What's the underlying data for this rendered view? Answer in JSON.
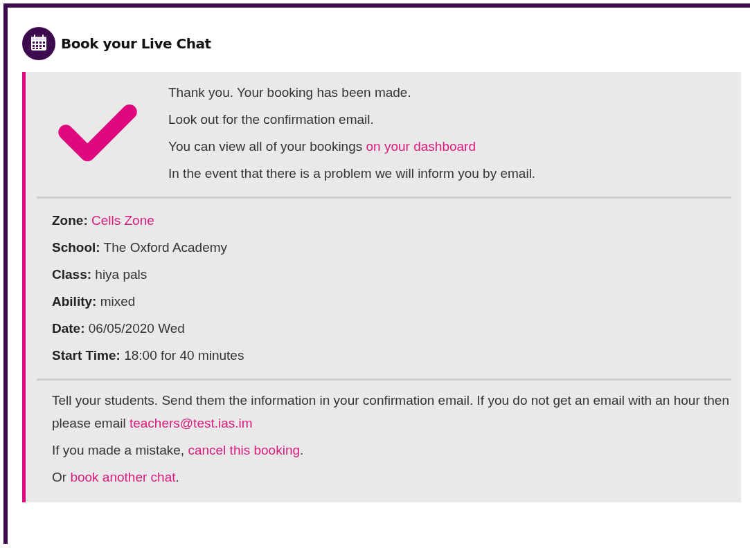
{
  "title": "Book your Live Chat",
  "confirmation": [
    [
      {
        "kind": "text",
        "text": "Thank you. Your booking has been made."
      }
    ],
    [
      {
        "kind": "text",
        "text": "Look out for the confirmation email."
      }
    ],
    [
      {
        "kind": "text",
        "text": "You can view all of your bookings "
      },
      {
        "kind": "link",
        "text": "on your dashboard"
      }
    ],
    [
      {
        "kind": "text",
        "text": "In the event that there is a problem we will inform you by email."
      }
    ]
  ],
  "details": [
    {
      "label": "Zone:",
      "value": "Cells Zone",
      "kind": "link"
    },
    {
      "label": "School:",
      "value": "The Oxford Academy",
      "kind": "text"
    },
    {
      "label": "Class:",
      "value": "hiya pals",
      "kind": "text"
    },
    {
      "label": "Ability:",
      "value": "mixed",
      "kind": "text"
    },
    {
      "label": "Date:",
      "value": "06/05/2020 Wed",
      "kind": "text"
    },
    {
      "label": "Start Time:",
      "value": "18:00 for 40 minutes",
      "kind": "text"
    }
  ],
  "next_steps": [
    [
      {
        "kind": "text",
        "text": "Tell your students. Send them the information in your confirmation email. If you do not get an email with an hour then please email "
      },
      {
        "kind": "link",
        "text": "teachers@test.ias.im"
      }
    ],
    [
      {
        "kind": "text",
        "text": "If you made a mistake, "
      },
      {
        "kind": "link",
        "text": "cancel this booking"
      },
      {
        "kind": "text",
        "text": "."
      }
    ],
    [
      {
        "kind": "text",
        "text": "Or "
      },
      {
        "kind": "link",
        "text": "book another chat"
      },
      {
        "kind": "text",
        "text": "."
      }
    ]
  ]
}
